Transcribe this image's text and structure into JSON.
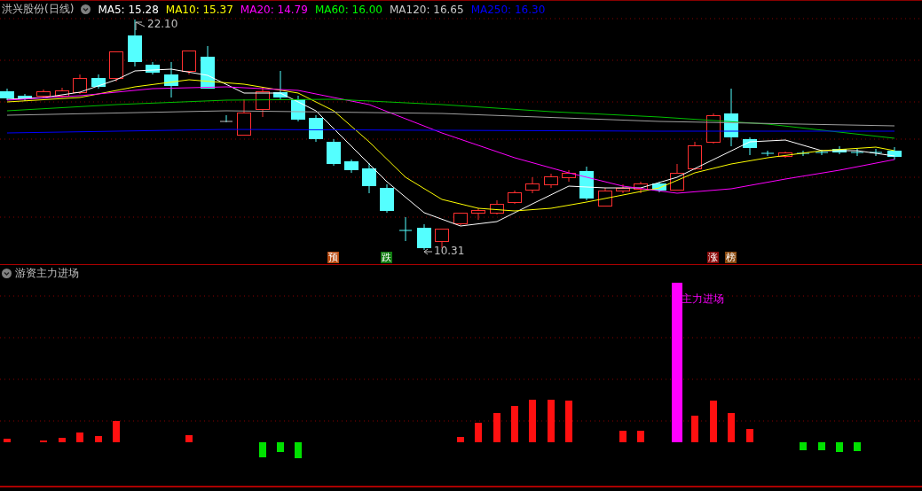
{
  "header": {
    "title": "洪兴股份(日线)",
    "ma_values": [
      {
        "text": "MA5: 15.28",
        "color": "#ffffff"
      },
      {
        "text": "MA10: 15.37",
        "color": "#ffff00"
      },
      {
        "text": "MA20: 14.79",
        "color": "#ff00ff"
      },
      {
        "text": "MA60: 16.00",
        "color": "#00ff00"
      },
      {
        "text": "MA120: 16.65",
        "color": "#c8c8c8"
      },
      {
        "text": "MA250: 16.30",
        "color": "#0000ff"
      }
    ]
  },
  "price_chart": {
    "high_label": "22.10",
    "low_label": "10.31",
    "badges": [
      {
        "text": "预",
        "color": "#b84a10"
      },
      {
        "text": "跌",
        "color": "#107a10"
      },
      {
        "text": "涨",
        "color": "#8a0a0a"
      },
      {
        "text": "榜",
        "color": "#8a4a10"
      }
    ]
  },
  "indicator": {
    "title": "游资主力进场",
    "signal_label": "主力进场"
  }
}
